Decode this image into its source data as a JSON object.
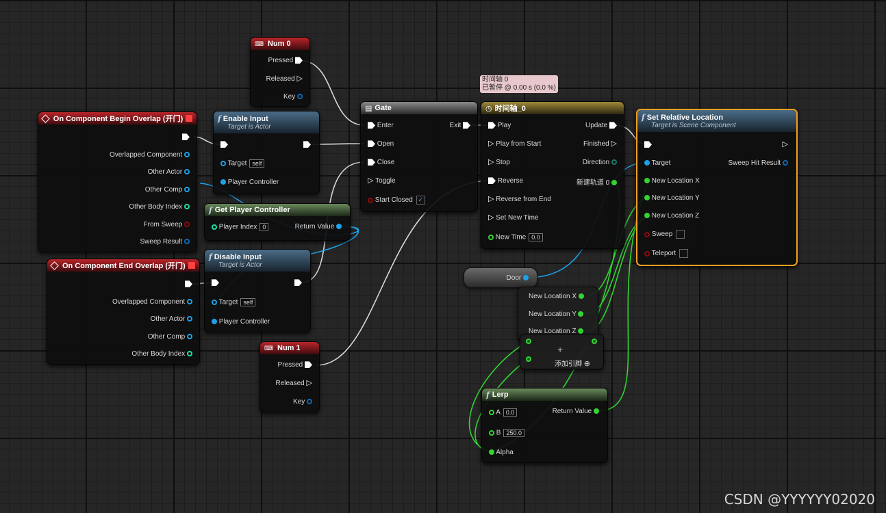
{
  "nodes": {
    "num0": {
      "title": "Num 0",
      "pressed": "Pressed",
      "released": "Released",
      "key": "Key"
    },
    "num1": {
      "title": "Num 1",
      "pressed": "Pressed",
      "released": "Released",
      "key": "Key"
    },
    "begin_overlap": {
      "title": "On Component Begin Overlap (开门)",
      "pins": [
        "Overlapped Component",
        "Other Actor",
        "Other Comp",
        "Other Body Index",
        "From Sweep",
        "Sweep Result"
      ]
    },
    "end_overlap": {
      "title": "On Component End Overlap (开门)",
      "pins": [
        "Overlapped Component",
        "Other Actor",
        "Other Comp",
        "Other Body Index"
      ]
    },
    "enable_input": {
      "title": "Enable Input",
      "subtitle": "Target is Actor",
      "target": "Target",
      "target_val": "self",
      "pc": "Player Controller"
    },
    "disable_input": {
      "title": "Disable Input",
      "subtitle": "Target is Actor",
      "target": "Target",
      "target_val": "self",
      "pc": "Player Controller"
    },
    "get_pc": {
      "title": "Get Player Controller",
      "index": "Player Index",
      "index_val": "0",
      "ret": "Return Value"
    },
    "gate": {
      "title": "Gate",
      "enter": "Enter",
      "open": "Open",
      "close": "Close",
      "toggle": "Toggle",
      "start_closed": "Start Closed",
      "exit": "Exit",
      "start_closed_checked": "✓"
    },
    "timeline": {
      "title": "时间轴_0",
      "tooltip_line1": "时间轴 0",
      "tooltip_line2": "已暂停 @ 0.00 s (0.0 %)",
      "inputs": [
        "Play",
        "Play from Start",
        "Stop",
        "Reverse",
        "Reverse from End",
        "Set New Time",
        "New Time"
      ],
      "new_time_val": "0.0",
      "outputs": [
        "Update",
        "Finished",
        "Direction",
        "新建轨道 0"
      ]
    },
    "set_rel": {
      "title": "Set Relative Location",
      "subtitle": "Target is Scene Component",
      "pins": [
        "Target",
        "New Location X",
        "New Location Y",
        "New Location Z",
        "Sweep",
        "Teleport"
      ],
      "sweep_hit": "Sweep Hit Result"
    },
    "door": {
      "label": "Door"
    },
    "make_vec": {
      "x": "New Location X",
      "y": "New Location Y",
      "z": "New Location Z",
      "add_pin": "添加引脚"
    },
    "lerp": {
      "title": "Lerp",
      "a": "A",
      "a_val": "0.0",
      "b": "B",
      "b_val": "250.0",
      "alpha": "Alpha",
      "ret": "Return Value"
    }
  },
  "watermark": "CSDN @YYYYYY02020",
  "colors": {
    "exec": "#ffffff",
    "object_pin": "#1ea1e8",
    "float_pin": "#33d433",
    "int_pin": "#1fe0a8",
    "bool_pin": "#8c0a0a",
    "struct_pin": "#0a6aba",
    "selection": "#f4a020"
  }
}
